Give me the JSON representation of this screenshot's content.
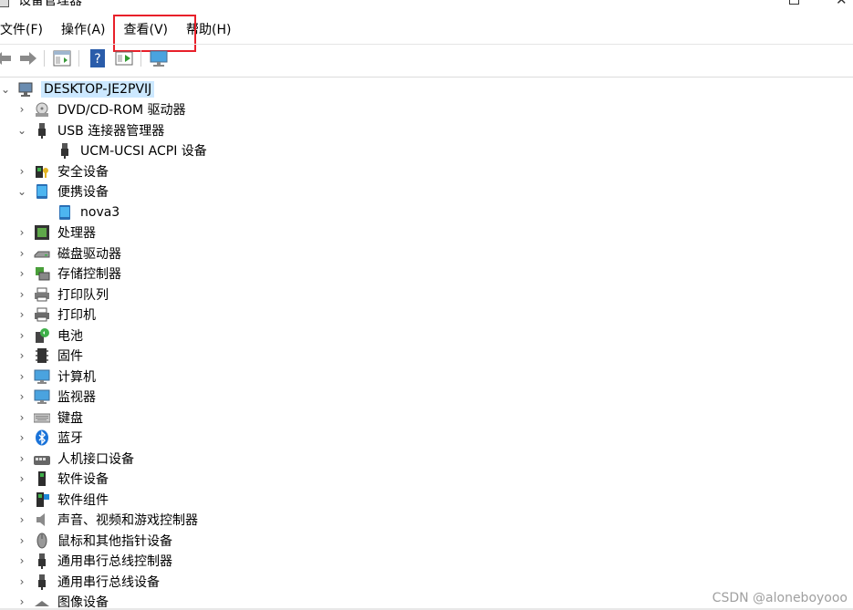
{
  "window": {
    "title": "设备管理器"
  },
  "menubar": {
    "items": [
      {
        "label": "文件(F)"
      },
      {
        "label": "操作(A)"
      },
      {
        "label": "查看(V)"
      },
      {
        "label": "帮助(H)"
      }
    ]
  },
  "toolbar": {
    "buttons": [
      "back-icon",
      "forward-icon",
      "properties-icon",
      "help-icon",
      "run-icon",
      "monitor-icon"
    ]
  },
  "tree": {
    "root": {
      "label": "DESKTOP-JE2PVIJ",
      "icon": "computer-icon",
      "expanded": true
    },
    "items": [
      {
        "label": "DVD/CD-ROM 驱动器",
        "icon": "dvd-icon",
        "expanded": false
      },
      {
        "label": "USB 连接器管理器",
        "icon": "usb-icon",
        "expanded": true,
        "children": [
          {
            "label": "UCM-UCSI ACPI 设备",
            "icon": "usb-icon"
          }
        ]
      },
      {
        "label": "安全设备",
        "icon": "security-icon",
        "expanded": false
      },
      {
        "label": "便携设备",
        "icon": "portable-device-icon",
        "expanded": true,
        "children": [
          {
            "label": "nova3",
            "icon": "portable-device-icon"
          }
        ]
      },
      {
        "label": "处理器",
        "icon": "processor-icon",
        "expanded": false
      },
      {
        "label": "磁盘驱动器",
        "icon": "disk-icon",
        "expanded": false
      },
      {
        "label": "存储控制器",
        "icon": "storage-controller-icon",
        "expanded": false
      },
      {
        "label": "打印队列",
        "icon": "print-queue-icon",
        "expanded": false
      },
      {
        "label": "打印机",
        "icon": "printer-icon",
        "expanded": false
      },
      {
        "label": "电池",
        "icon": "battery-icon",
        "expanded": false
      },
      {
        "label": "固件",
        "icon": "firmware-icon",
        "expanded": false
      },
      {
        "label": "计算机",
        "icon": "computer-icon",
        "expanded": false
      },
      {
        "label": "监视器",
        "icon": "monitor-icon",
        "expanded": false
      },
      {
        "label": "键盘",
        "icon": "keyboard-icon",
        "expanded": false
      },
      {
        "label": "蓝牙",
        "icon": "bluetooth-icon",
        "expanded": false
      },
      {
        "label": "人机接口设备",
        "icon": "hid-icon",
        "expanded": false
      },
      {
        "label": "软件设备",
        "icon": "software-device-icon",
        "expanded": false
      },
      {
        "label": "软件组件",
        "icon": "software-component-icon",
        "expanded": false
      },
      {
        "label": "声音、视频和游戏控制器",
        "icon": "sound-icon",
        "expanded": false
      },
      {
        "label": "鼠标和其他指针设备",
        "icon": "mouse-icon",
        "expanded": false
      },
      {
        "label": "通用串行总线控制器",
        "icon": "usb-icon",
        "expanded": false
      },
      {
        "label": "通用串行总线设备",
        "icon": "usb-icon",
        "expanded": false
      },
      {
        "label": "图像设备",
        "icon": "imaging-icon",
        "expanded": false
      }
    ]
  },
  "watermark": "CSDN @aloneboyooo",
  "colors": {
    "highlight_box": "#e8202a",
    "selection": "#cce8ff"
  }
}
